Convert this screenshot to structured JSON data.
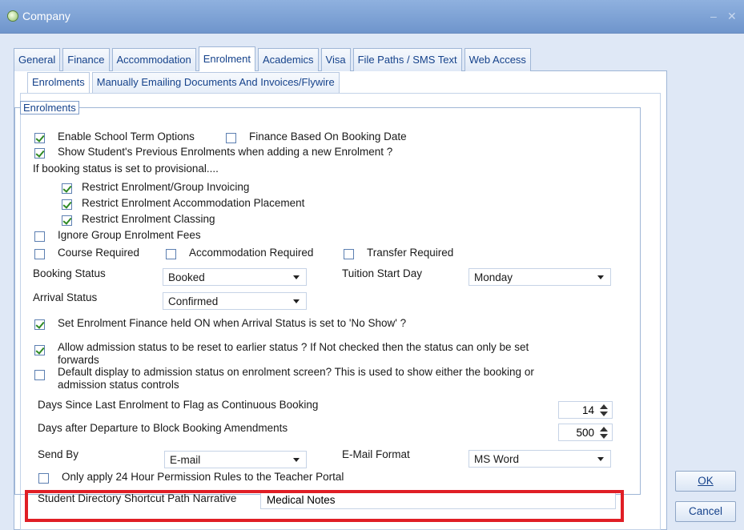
{
  "window": {
    "title": "Company"
  },
  "tabs": [
    "General",
    "Finance",
    "Accommodation",
    "Enrolment",
    "Academics",
    "Visa",
    "File Paths / SMS Text",
    "Web Access"
  ],
  "subtabs": [
    "Enrolments",
    "Manually Emailing Documents And Invoices/Flywire"
  ],
  "group_title": "Enrolments",
  "options": {
    "enable_school_term": "Enable School Term Options",
    "finance_based_on_booking_date": "Finance Based On Booking Date",
    "show_previous_enrolments": "Show Student's Previous Enrolments when adding a new Enrolment ?",
    "provisional_heading": "If booking status is set to provisional....",
    "restrict_invoicing": "Restrict Enrolment/Group Invoicing",
    "restrict_accommodation": "Restrict Enrolment Accommodation Placement",
    "restrict_classing": "Restrict Enrolment Classing",
    "ignore_group_fees": "Ignore Group Enrolment Fees",
    "course_required": "Course Required",
    "accommodation_required": "Accommodation Required",
    "transfer_required": "Transfer Required",
    "set_finance_held": "Set Enrolment Finance held ON when Arrival Status is set to 'No Show' ?",
    "allow_admission_reset_1": "Allow admission status to be reset to earlier status ? If Not checked then the status can only be set",
    "allow_admission_reset_2": "forwards",
    "default_display_1": "Default display to admission status on enrolment screen? This is used to show either the booking or",
    "default_display_2": "admission status controls",
    "only_apply_24": "Only apply 24 Hour Permission Rules to the Teacher Portal"
  },
  "fields": {
    "booking_status_label": "Booking Status",
    "booking_status_value": "Booked",
    "tuition_start_label": "Tuition Start Day",
    "tuition_start_value": "Monday",
    "arrival_status_label": "Arrival Status",
    "arrival_status_value": "Confirmed",
    "days_since_label": "Days Since Last Enrolment to Flag as Continuous Booking",
    "days_since_value": "14",
    "days_after_label": "Days after Departure to Block Booking Amendments",
    "days_after_value": "500",
    "send_by_label": "Send By",
    "send_by_value": "E-mail",
    "email_format_label": "E-Mail Format",
    "email_format_value": "MS Word",
    "directory_label": "Student Directory Shortcut Path Narrative",
    "directory_value": "Medical Notes"
  },
  "buttons": {
    "ok": "OK",
    "cancel": "Cancel"
  },
  "colors": {
    "highlight": "#e01e25",
    "accent": "#15428b"
  }
}
